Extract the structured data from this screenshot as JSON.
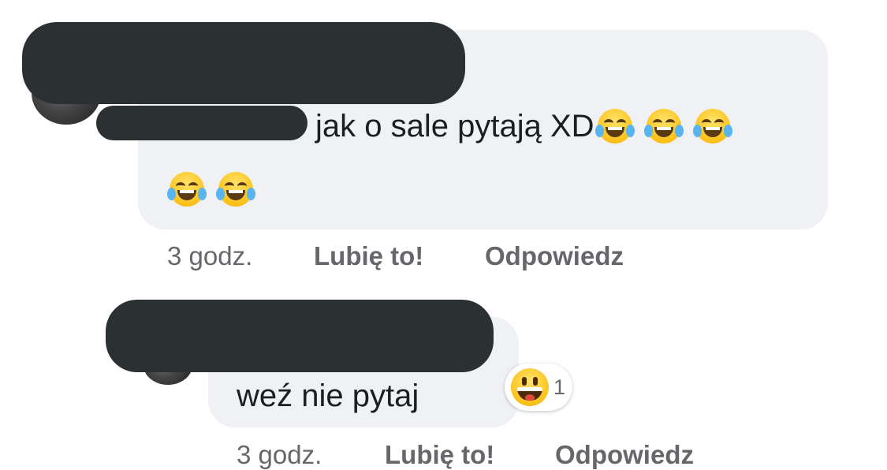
{
  "comments": [
    {
      "author_hidden": true,
      "text": "jak o sale pytają XD",
      "emoji": [
        "face-with-tears-of-joy",
        "face-with-tears-of-joy",
        "face-with-tears-of-joy",
        "face-with-tears-of-joy",
        "face-with-tears-of-joy"
      ],
      "time": "3 godz.",
      "like_label": "Lubię to!",
      "reply_label": "Odpowiedz"
    },
    {
      "author_hidden": true,
      "text": "weź nie pytaj",
      "reaction": {
        "icon": "grinning-face",
        "count": "1"
      },
      "time": "3 godz.",
      "like_label": "Lubię to!",
      "reply_label": "Odpowiedz"
    }
  ],
  "colors": {
    "bubble": "#f0f1f4",
    "redaction": "#2b3033",
    "meta_text": "#65676b",
    "text": "#1c1e21"
  }
}
